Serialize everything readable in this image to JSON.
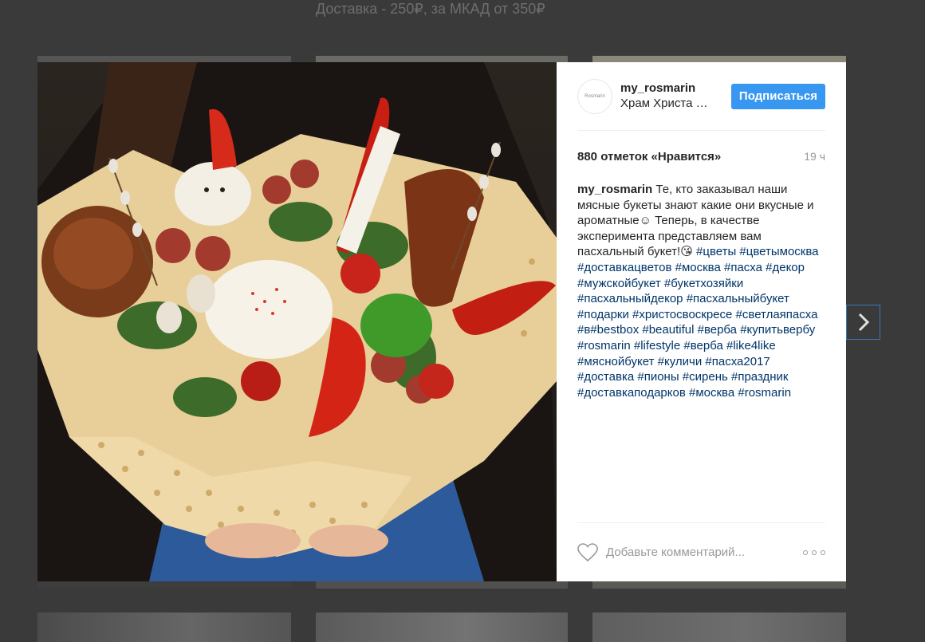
{
  "background": {
    "caption": "Доставка - 250₽, за МКАД от 350₽"
  },
  "post": {
    "photo_alt": "Мясной пасхальный букет",
    "header": {
      "avatar_text": "Rosmarin",
      "username": "my_rosmarin",
      "location": "Храм Христа Спасителя",
      "follow_label": "Подписаться"
    },
    "likes": "880 отметок «Нравится»",
    "time": "19 ч",
    "caption": {
      "username": "my_rosmarin",
      "text_1": "Те, кто заказывал наши мясные букеты знают какие они вкусные и ароматные☺ Теперь, в качестве эксперимента представляем вам пасхальный букет!😘",
      "hashtags": [
        "#цветы",
        "#цветымосква",
        "#доставкацветов",
        "#москва",
        "#пасха",
        "#декор",
        "#мужскойбукет",
        "#букетхозяйки",
        "#пасхальныйдекор",
        "#пасхальныйбукет",
        "#подарки",
        "#христосвоскресе",
        "#светлаяпасха",
        "#в#bestbox",
        "#beautiful",
        "#верба",
        "#купитьвербу",
        "#rosmarin",
        "#lifestyle",
        "#верба",
        "#like4like",
        "#мяснойбукет",
        "#куличи",
        "#пасха2017",
        "#доставка",
        "#пионы",
        "#сирень",
        "#праздник",
        "#доставкаподарков",
        "#москва",
        "#rosmarin"
      ]
    },
    "comment_placeholder": "Добавьте комментарий..."
  },
  "colors": {
    "accent": "#3897f0",
    "hashtag": "#003569",
    "overlay": "#3a3a3a"
  },
  "icons": [
    "heart-icon",
    "more-options-icon",
    "chevron-right-icon"
  ]
}
